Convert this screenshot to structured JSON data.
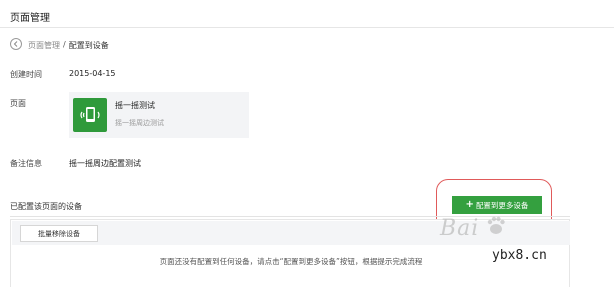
{
  "header": {
    "title": "页面管理"
  },
  "breadcrumb": {
    "parent": "页面管理",
    "separator": "/",
    "current": "配置到设备"
  },
  "fields": {
    "created_label": "创建时间",
    "created_value": "2015-04-15",
    "page_label": "页面",
    "remark_label": "备注信息",
    "remark_value": "摇一摇周边配置测试"
  },
  "page_card": {
    "title": "摇一摇测试",
    "subtitle": "摇一摇周边测试",
    "thumb_icon": "shake-phone-icon"
  },
  "devices": {
    "section_label": "已配置该页面的设备",
    "add_button": {
      "icon": "+",
      "label": "配置到更多设备"
    },
    "batch_remove_label": "批量移除设备",
    "empty_note": "页面还没有配置到任何设备，请点击“配置到更多设备”按钮，根据提示完成流程"
  },
  "watermark": {
    "brand": "Bai",
    "site": "ybx8.cn"
  },
  "colors": {
    "accent_green": "#34a03f",
    "highlight_red": "#e05a5a"
  }
}
